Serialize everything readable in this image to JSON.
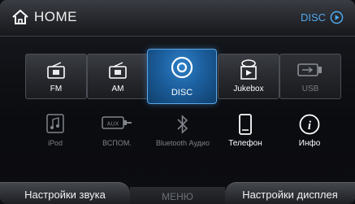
{
  "header": {
    "title": "HOME",
    "disc_link_label": "DISC"
  },
  "tiles": [
    {
      "label": "FM",
      "icon": "radio-icon",
      "state": "normal"
    },
    {
      "label": "AM",
      "icon": "radio-icon",
      "state": "normal"
    },
    {
      "label": "DISC",
      "icon": "disc-icon",
      "state": "selected"
    },
    {
      "label": "Jukebox",
      "icon": "jukebox-icon",
      "state": "normal"
    },
    {
      "label": "USB",
      "icon": "usb-icon",
      "state": "disabled"
    }
  ],
  "row2": [
    {
      "label": "iPod",
      "icon": "music-note-icon",
      "state": "disabled"
    },
    {
      "label": "ВСПОМ.",
      "icon": "aux-icon",
      "state": "disabled"
    },
    {
      "label": "Bluetooth Аудио",
      "icon": "bluetooth-icon",
      "state": "disabled"
    },
    {
      "label": "Телефон",
      "icon": "phone-icon",
      "state": "normal"
    },
    {
      "label": "Инфо",
      "icon": "info-icon",
      "state": "normal"
    }
  ],
  "bottom": {
    "left": "Настройки звука",
    "middle": "МЕНЮ",
    "right": "Настройки дисплея"
  },
  "colors": {
    "accent": "#4fa9ef",
    "selected_tile": "#1c5f9e",
    "disabled_text": "#777b82"
  }
}
